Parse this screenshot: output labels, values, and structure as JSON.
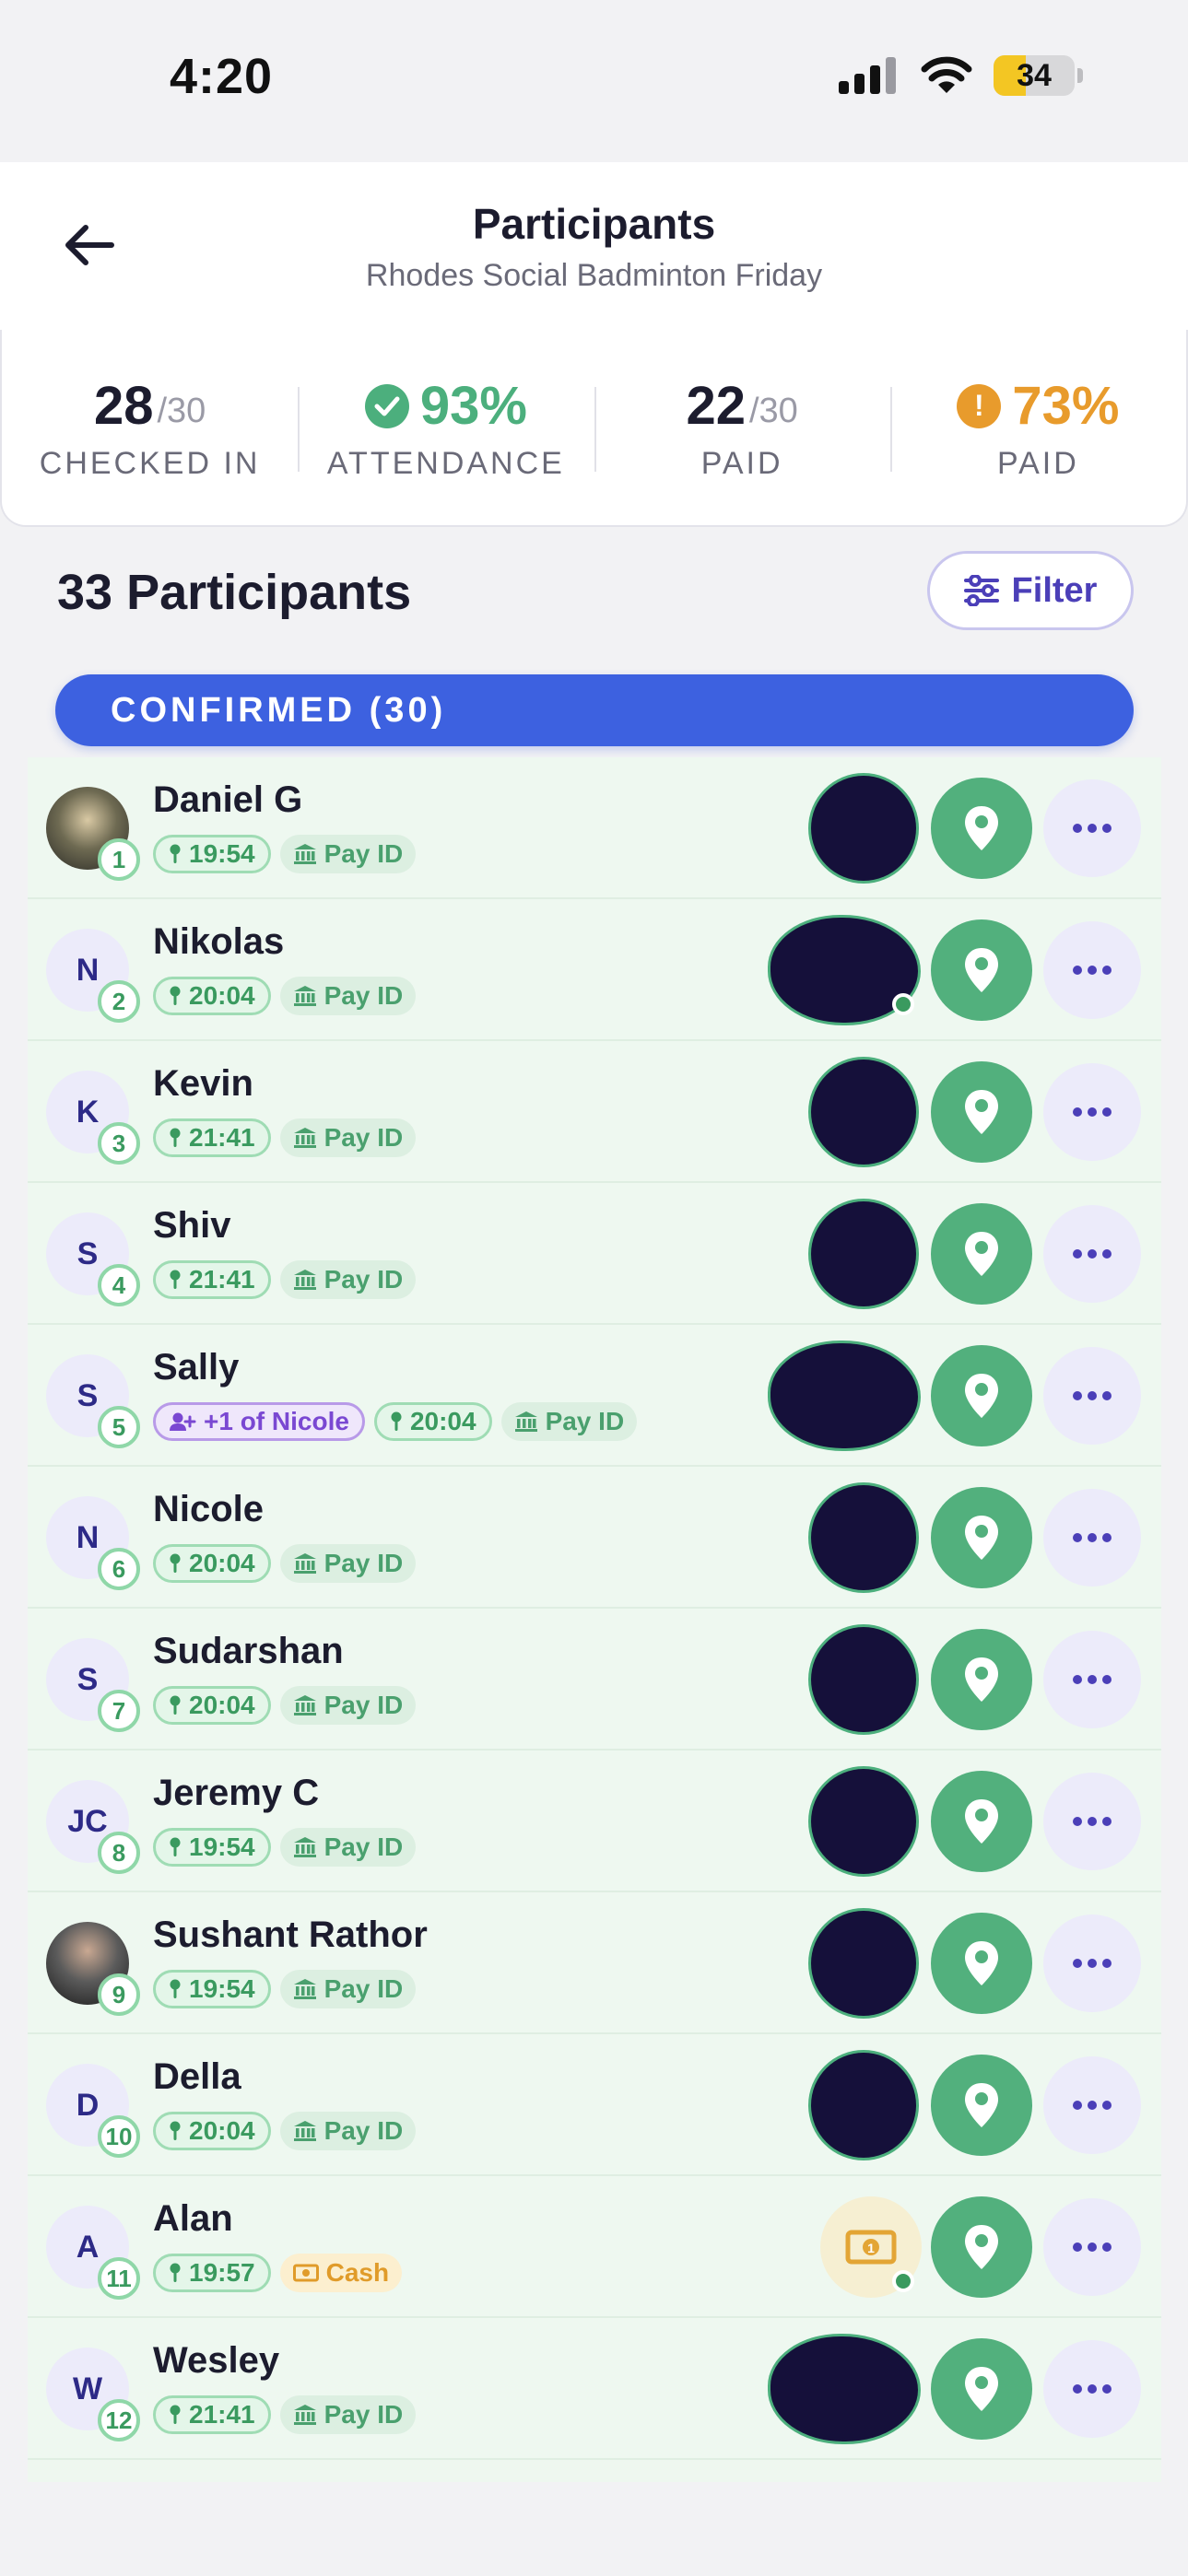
{
  "status_bar": {
    "time": "4:20",
    "battery": "34"
  },
  "header": {
    "title": "Participants",
    "subtitle": "Rhodes Social Badminton Friday"
  },
  "stats": [
    {
      "big": "28",
      "small": "/30",
      "label": "CHECKED IN"
    },
    {
      "big": "93%",
      "small": "",
      "label": "ATTENDANCE",
      "icon": "check-circle-icon",
      "color": "#4caf7d"
    },
    {
      "big": "22",
      "small": "/30",
      "label": "PAID"
    },
    {
      "big": "73%",
      "small": "",
      "label": "PAID",
      "icon": "warning-circle-icon",
      "icon_text": "!",
      "color": "#e89b2c"
    }
  ],
  "participants_title": "33 Participants",
  "filter_label": "Filter",
  "section_label": "CONFIRMED (30)",
  "participants": [
    {
      "name": "Daniel G",
      "initials": "",
      "number": "1",
      "time": "19:54",
      "payment": "Pay ID",
      "photo": true
    },
    {
      "name": "Nikolas",
      "initials": "N",
      "number": "2",
      "time": "20:04",
      "payment": "Pay ID"
    },
    {
      "name": "Kevin",
      "initials": "K",
      "number": "3",
      "time": "21:41",
      "payment": "Pay ID"
    },
    {
      "name": "Shiv",
      "initials": "S",
      "number": "4",
      "time": "21:41",
      "payment": "Pay ID"
    },
    {
      "name": "Sally",
      "initials": "S",
      "number": "5",
      "guest_of": "+1 of Nicole",
      "time": "20:04",
      "payment": "Pay ID"
    },
    {
      "name": "Nicole",
      "initials": "N",
      "number": "6",
      "time": "20:04",
      "payment": "Pay ID"
    },
    {
      "name": "Sudarshan",
      "initials": "S",
      "number": "7",
      "time": "20:04",
      "payment": "Pay ID"
    },
    {
      "name": "Jeremy C",
      "initials": "JC",
      "number": "8",
      "time": "19:54",
      "payment": "Pay ID"
    },
    {
      "name": "Sushant Rathor",
      "initials": "",
      "number": "9",
      "time": "19:54",
      "payment": "Pay ID",
      "photo": true
    },
    {
      "name": "Della",
      "initials": "D",
      "number": "10",
      "time": "20:04",
      "payment": "Pay ID"
    },
    {
      "name": "Alan",
      "initials": "A",
      "number": "11",
      "time": "19:57",
      "payment": "Cash",
      "cash": true
    },
    {
      "name": "Wesley",
      "initials": "W",
      "number": "12",
      "time": "21:41",
      "payment": "Pay ID"
    }
  ]
}
